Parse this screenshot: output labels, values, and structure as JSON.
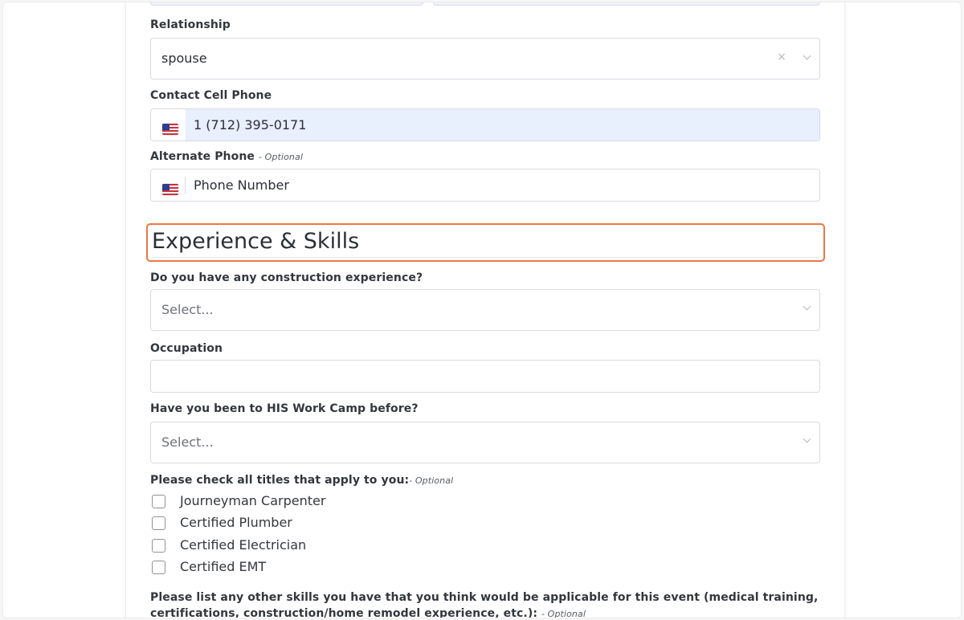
{
  "emergency_contact": {
    "relationship_label": "Relationship",
    "relationship_value": "spouse",
    "relationship_clear_glyph": "×",
    "cell_phone_label": "Contact Cell Phone",
    "cell_phone_value": "1 (712) 395-0171",
    "alt_phone_label": "Alternate Phone",
    "alt_phone_optional": "- Optional",
    "alt_phone_placeholder": "Phone Number",
    "flag_icon": "us-flag-icon"
  },
  "experience": {
    "section_title": "Experience & Skills",
    "construction_label": "Do you have any construction experience?",
    "construction_placeholder": "Select...",
    "occupation_label": "Occupation",
    "occupation_value": "",
    "work_camp_label": "Have you been to HIS Work Camp before?",
    "work_camp_placeholder": "Select...",
    "titles_label": "Please check all titles that apply to you:",
    "titles_optional": "- Optional",
    "titles": [
      {
        "label": "Journeyman Carpenter",
        "checked": false
      },
      {
        "label": "Certified Plumber",
        "checked": false
      },
      {
        "label": "Certified Electrician",
        "checked": false
      },
      {
        "label": "Certified EMT",
        "checked": false
      }
    ],
    "skills_label_line1": "Please list any other skills you have that you think would be applicable for this event (medical training,",
    "skills_label_line2": "certifications, construction/home remodel experience, etc.):",
    "skills_optional": "- Optional"
  },
  "colors": {
    "focus_outline": "#ee7744",
    "autofill_bg": "#e8effd",
    "border": "#d9dbe0",
    "text": "#2b2f36"
  }
}
